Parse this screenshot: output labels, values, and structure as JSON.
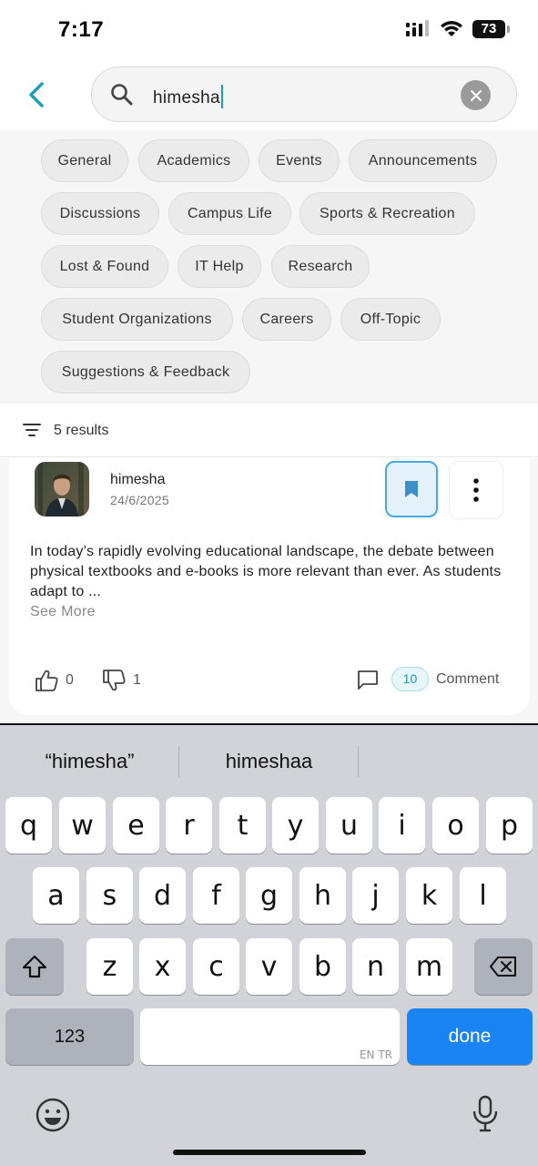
{
  "status": {
    "time": "7:17",
    "battery": "73"
  },
  "search": {
    "query": "himesha"
  },
  "categories": [
    "General",
    "Academics",
    "Events",
    "Announcements",
    "Discussions",
    "Campus Life",
    "Sports & Recreation",
    "Lost & Found",
    "IT Help",
    "Research",
    "Student Organizations",
    "Careers",
    "Off-Topic",
    "Suggestions & Feedback"
  ],
  "results": {
    "count_label": "5 results"
  },
  "post": {
    "author": "himesha",
    "date": "24/6/2025",
    "body": "In today’s rapidly evolving educational landscape, the debate between physical textbooks and e-books is more relevant than ever. As students adapt to ...",
    "see_more": "See More",
    "likes": "0",
    "dislikes": "1",
    "comment_count": "10",
    "comment_label": "Comment",
    "bookmarked": true
  },
  "keyboard": {
    "suggestions": [
      "“himesha”",
      "himeshaa"
    ],
    "row1": [
      "q",
      "w",
      "e",
      "r",
      "t",
      "y",
      "u",
      "i",
      "o",
      "p"
    ],
    "row2": [
      "a",
      "s",
      "d",
      "f",
      "g",
      "h",
      "j",
      "k",
      "l"
    ],
    "row3": [
      "z",
      "x",
      "c",
      "v",
      "b",
      "n",
      "m"
    ],
    "numbers_label": "123",
    "done_label": "done",
    "space_hint": "EN TR"
  },
  "colors": {
    "accent": "#1a9fb8",
    "bookmark": "#4aa8de",
    "done_key": "#1a84f5"
  }
}
